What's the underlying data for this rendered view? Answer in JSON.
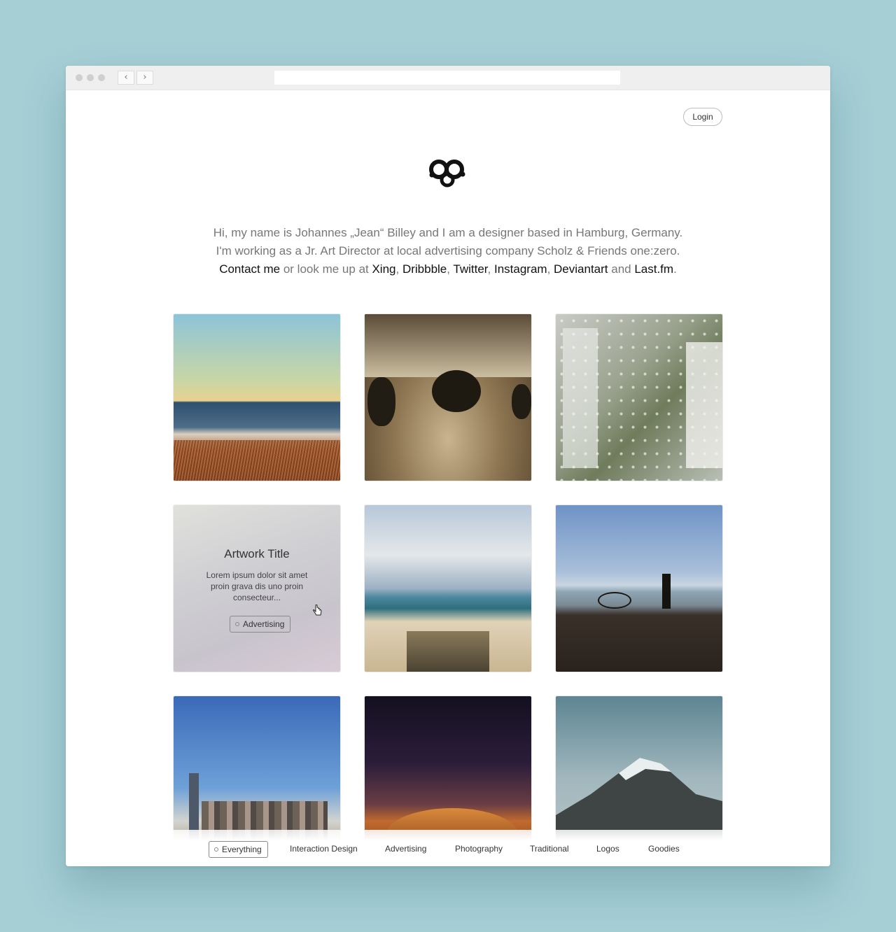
{
  "header": {
    "login_label": "Login"
  },
  "intro": {
    "line1": "Hi, my name is Johannes „Jean“ Billey and I am a designer based in Hamburg, Germany.",
    "line2": "I'm working as a Jr. Art Director at local advertising company Scholz & Friends one:zero.",
    "line3_links": {
      "contact": "Contact me",
      "middle": " or look me up at ",
      "xing": "Xing",
      "sep1": ", ",
      "dribbble": "Dribbble",
      "sep2": ", ",
      "twitter": "Twitter",
      "sep3": ", ",
      "instagram": "Instagram",
      "sep4": ", ",
      "deviantart": "Deviantart",
      "and": " and ",
      "lastfm": "Last.fm",
      "end": "."
    }
  },
  "hover_tile": {
    "title": "Artwork Title",
    "description": "Lorem ipsum dolor sit amet proin grava dis uno proin consecteur...",
    "tag": "Advertising"
  },
  "filters": {
    "everything": "Everything",
    "interaction": "Interaction Design",
    "advertising": "Advertising",
    "photography": "Photography",
    "traditional": "Traditional",
    "logos": "Logos",
    "goodies": "Goodies"
  },
  "colors": {
    "background": "#a5ced5",
    "window": "#ffffff",
    "titlebar": "#efefef",
    "text_light": "#777777",
    "text_dark": "#111111"
  }
}
